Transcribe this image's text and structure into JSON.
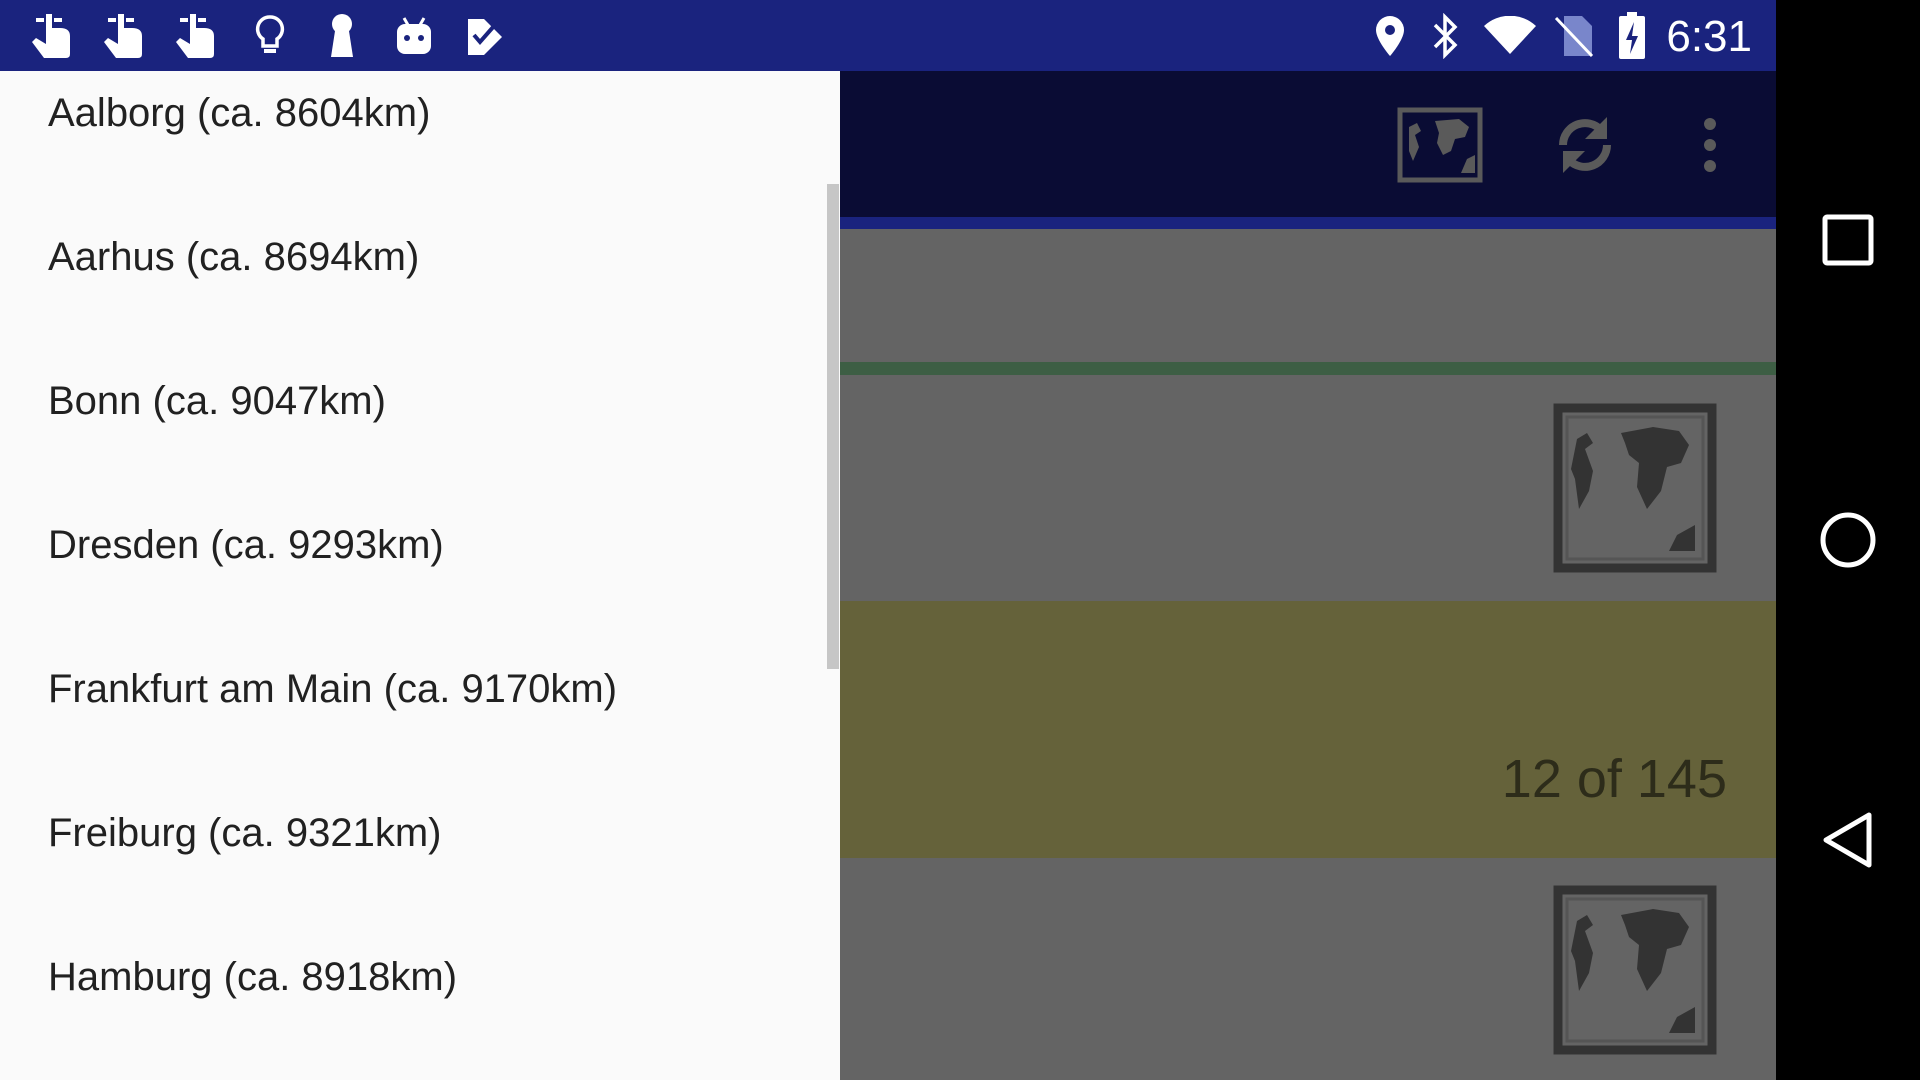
{
  "status_bar": {
    "time": "6:31",
    "left_icons": [
      "hand-pointer-icon",
      "hand-pointer-icon",
      "hand-pointer-icon",
      "lightbulb-icon",
      "keyhole-icon",
      "android-icon",
      "checkmark-icon"
    ],
    "right_icons": [
      "location-pin-icon",
      "bluetooth-icon",
      "wifi-icon",
      "no-sim-icon",
      "battery-charging-icon"
    ]
  },
  "toolbar": {
    "actions": [
      "map-icon",
      "refresh-icon",
      "more-vert-icon"
    ]
  },
  "content": {
    "counter": "12 of 145"
  },
  "drawer": {
    "items": [
      {
        "label": "Aalborg (ca. 8604km)"
      },
      {
        "label": "Aarhus (ca. 8694km)"
      },
      {
        "label": "Bonn (ca. 9047km)"
      },
      {
        "label": "Dresden (ca. 9293km)"
      },
      {
        "label": "Frankfurt am Main (ca. 9170km)"
      },
      {
        "label": "Freiburg (ca. 9321km)"
      },
      {
        "label": "Hamburg (ca. 8918km)"
      }
    ]
  },
  "nav_bar": {
    "buttons": [
      "recents-square-icon",
      "home-circle-icon",
      "back-triangle-icon"
    ]
  },
  "colors": {
    "status_bar": "#1a237e",
    "toolbar": "#0a0c34",
    "drawer_bg": "#fafafa",
    "scrim_gray": "#646464",
    "highlight_olive": "#65623a",
    "divider_green": "#3d5e44"
  }
}
